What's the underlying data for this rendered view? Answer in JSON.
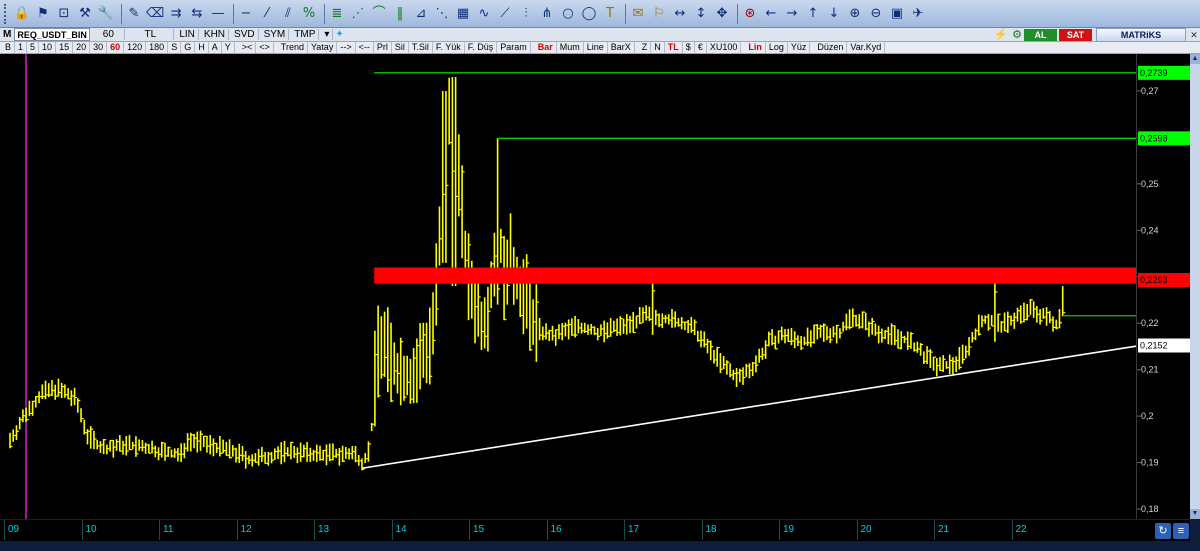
{
  "toolbar": {
    "icons": [
      "lock-icon",
      "percent-flag-icon",
      "frame-icon",
      "tools-icon",
      "wrench-icon",
      "pencil-eraser-icon",
      "eraser-icon",
      "parallel-lines-icon",
      "double-arrow-icon",
      "dash-icon",
      "minus-icon",
      "trend-lines-icon",
      "fan-lines-icon",
      "percent-icon",
      "fibonacci-icon",
      "fib-fan-icon",
      "fib-arc-icon",
      "fib-time-icon",
      "gann-icon",
      "gann-fan-icon",
      "gann-box-icon",
      "cycle-icon",
      "regression-icon",
      "channel-icon",
      "pitchfork-icon",
      "circle-icon",
      "ellipse-icon",
      "text-icon",
      "note-icon",
      "flag-icon",
      "arrows-h-icon",
      "arrows-v-icon",
      "move-icon",
      "zoom-reset-icon",
      "arrow-left-icon",
      "arrow-right-icon",
      "arrow-up-icon",
      "arrow-down-icon",
      "zoom-in-icon",
      "zoom-out-icon",
      "image-icon",
      "rocket-icon"
    ]
  },
  "row2": {
    "m_label": "M",
    "symbol": "REQ_USDT_BIN",
    "period": "60",
    "currency": "TL",
    "buttons": [
      "LIN",
      "KHN",
      "SVD",
      "SYM",
      "TMP",
      "▾"
    ],
    "al_label": "AL",
    "sat_label": "SAT",
    "brand": "MATRiKS",
    "colors": {
      "al": "#1f8f2a",
      "sat": "#d11212"
    }
  },
  "row3": {
    "periods": [
      "B",
      "1",
      "5",
      "10",
      "15",
      "20",
      "30",
      "60",
      "120",
      "180",
      "S",
      "G",
      "H",
      "A",
      "Y"
    ],
    "active_period": "60",
    "nav": [
      "><",
      "<>"
    ],
    "tools": [
      "Trend",
      "Yatay",
      "-->",
      "<--",
      "Prl",
      "Sil",
      "T.Sil",
      "F. Yük",
      "F. Düş",
      "Param"
    ],
    "modes": [
      "Bar",
      "Mum",
      "Line",
      "BarX"
    ],
    "active_mode": "Bar",
    "currencies": [
      "Z",
      "N",
      "TL",
      "$",
      "€",
      "XU100"
    ],
    "active_currency": "TL",
    "scales": [
      "Lin",
      "Log",
      "Yüz"
    ],
    "active_scale": "Lin",
    "extra": [
      "Düzen",
      "Var.Kyd"
    ]
  },
  "chart_data": {
    "type": "bar",
    "symbol": "REQ_USDT_BIN",
    "interval": "60",
    "x_labels": [
      "09",
      "10",
      "11",
      "12",
      "13",
      "14",
      "15",
      "16",
      "17",
      "18",
      "19",
      "20",
      "21",
      "22"
    ],
    "y_ticks": [
      0.18,
      0.19,
      0.2,
      0.21,
      0.22,
      0.23,
      0.24,
      0.25,
      0.26,
      0.27
    ],
    "ylim": [
      0.18,
      0.2715
    ],
    "price_labels": [
      {
        "value": 0.2739,
        "text": "0,2739",
        "bg": "#00ff00",
        "fg": "#000000"
      },
      {
        "value": 0.2598,
        "text": "0,2598",
        "bg": "#00ff00",
        "fg": "#000000"
      },
      {
        "value": 0.2293,
        "text": "0,2293",
        "bg": "#ff0000",
        "fg": "#000000"
      },
      {
        "value": 0.2152,
        "text": "0,2152",
        "bg": "#ffffff",
        "fg": "#000000"
      }
    ],
    "resistance_lines": [
      0.2739,
      0.2598
    ],
    "resistance_zone": [
      0.2285,
      0.232
    ],
    "trendline": {
      "from": {
        "day": 13.55,
        "price": 0.1888
      },
      "to": {
        "day": 22.95,
        "price": 0.2152
      }
    },
    "last_price_line": 0.2216,
    "bar_color": "#ffff00",
    "colors": {
      "resistance": "#00d000",
      "zone": "#ff0000",
      "trend": "#ffffff",
      "axis_text": "#00cfd6",
      "separator": "#9b1b9b"
    }
  }
}
